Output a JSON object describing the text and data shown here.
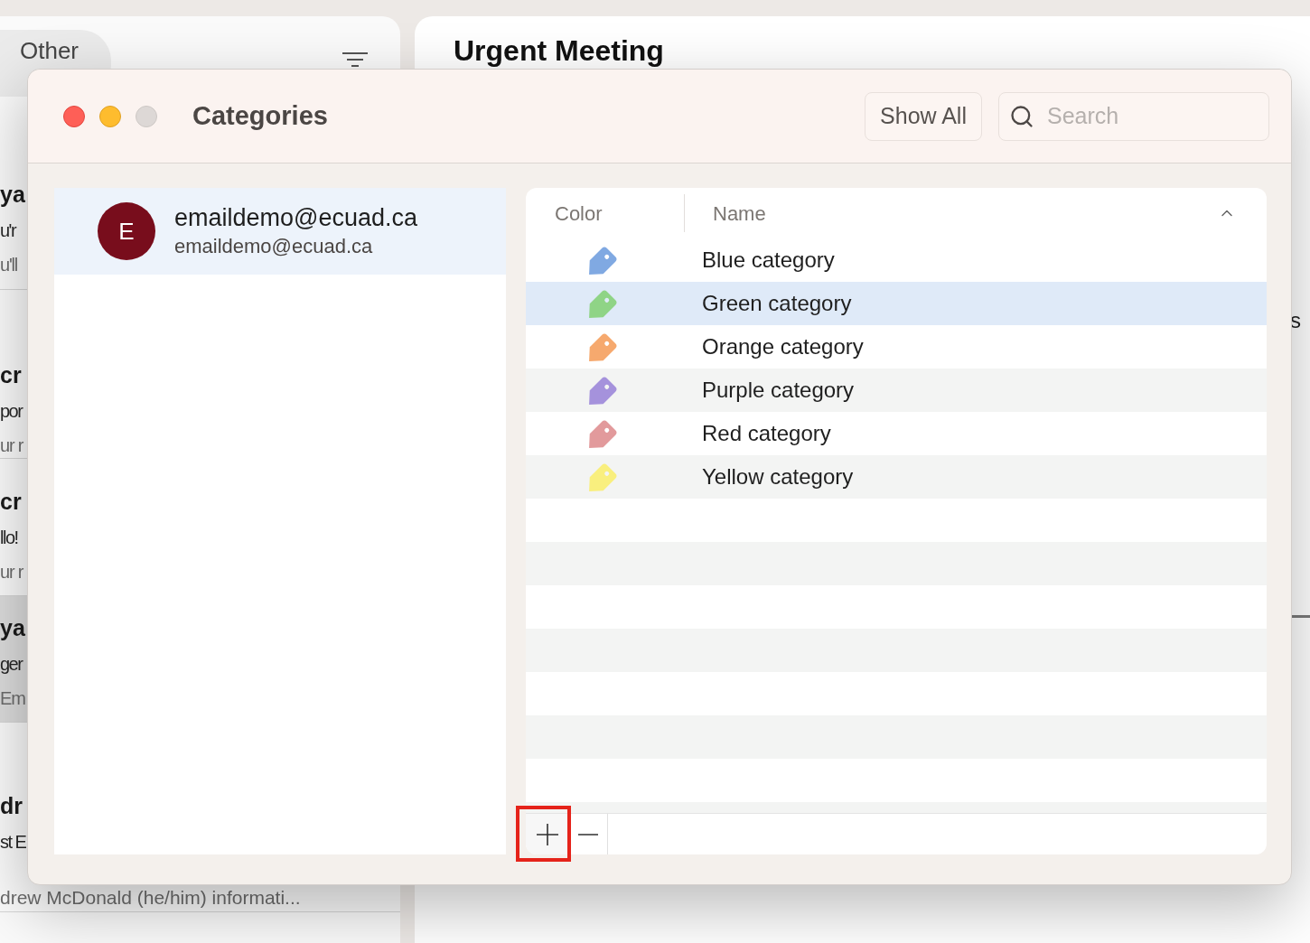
{
  "mail_app": {
    "folder_tab": "Other",
    "list": [
      {
        "lines": [
          "ya",
          "u'r",
          "u'll"
        ],
        "selected": false
      },
      {
        "lines": [
          "cr",
          "por",
          "ur r"
        ],
        "selected": false
      },
      {
        "lines": [
          "cr",
          "llo!",
          "ur r"
        ],
        "selected": false
      },
      {
        "lines": [
          "ya",
          "ger",
          "Em"
        ],
        "selected": true
      },
      {
        "lines": [
          "dr",
          "st E",
          "drew McDonald (he/him) informati..."
        ],
        "selected": false
      }
    ],
    "message_title": "Urgent Meeting",
    "message_fragment": "s"
  },
  "dialog": {
    "window_controls": [
      {
        "kind": "close",
        "enabled": true
      },
      {
        "kind": "minimize",
        "enabled": true
      },
      {
        "kind": "zoom",
        "enabled": false
      }
    ],
    "title": "Categories",
    "show_all_button": "Show All",
    "search": {
      "placeholder": "Search"
    },
    "accounts": [
      {
        "initial": "E",
        "name": "emaildemo@ecuad.ca",
        "address": "emaildemo@ecuad.ca",
        "selected": true
      }
    ],
    "table": {
      "columns": [
        {
          "label": "Color"
        },
        {
          "label": "Name",
          "sorted_ascending": true
        }
      ],
      "rows": [
        {
          "name": "Blue category",
          "color": "#80a9e2",
          "selected": false
        },
        {
          "name": "Green category",
          "color": "#8fd486",
          "selected": true
        },
        {
          "name": "Orange category",
          "color": "#f6a96e",
          "selected": false
        },
        {
          "name": "Purple category",
          "color": "#a592dc",
          "selected": false
        },
        {
          "name": "Red category",
          "color": "#e29a9c",
          "selected": false
        },
        {
          "name": "Yellow category",
          "color": "#f9ef7e",
          "selected": false
        }
      ]
    },
    "toolbar": [
      {
        "kind": "add",
        "highlighted": true
      },
      {
        "kind": "remove",
        "highlighted": false
      }
    ]
  }
}
